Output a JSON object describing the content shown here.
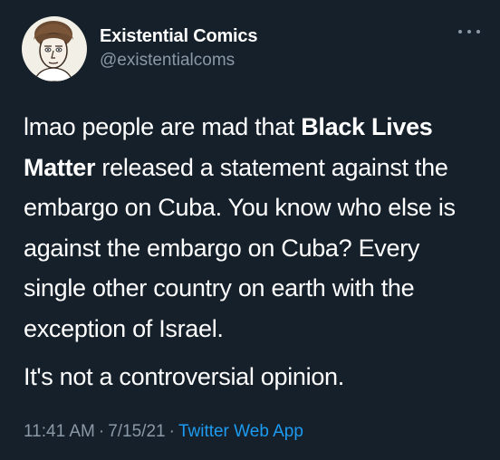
{
  "author": {
    "name": "Existential Comics",
    "handle": "@existentialcoms"
  },
  "tweet": {
    "part1": "lmao people are mad that ",
    "bold": "Black Lives Matter",
    "part2": " released a statement against the embargo on Cuba. You know who else is against the embargo on Cuba? Every single other country on earth with the exception of Israel.",
    "paragraph2": "It's not a controversial opinion."
  },
  "meta": {
    "time": "11:41 AM",
    "date": "7/15/21",
    "separator": "·",
    "source": "Twitter Web App"
  },
  "icons": {
    "avatar": "cartoon-portrait",
    "more": "more-horizontal-icon"
  },
  "colors": {
    "background": "#15202b",
    "text": "#ffffff",
    "secondary": "#8b98a5",
    "link": "#1d9bf0"
  }
}
